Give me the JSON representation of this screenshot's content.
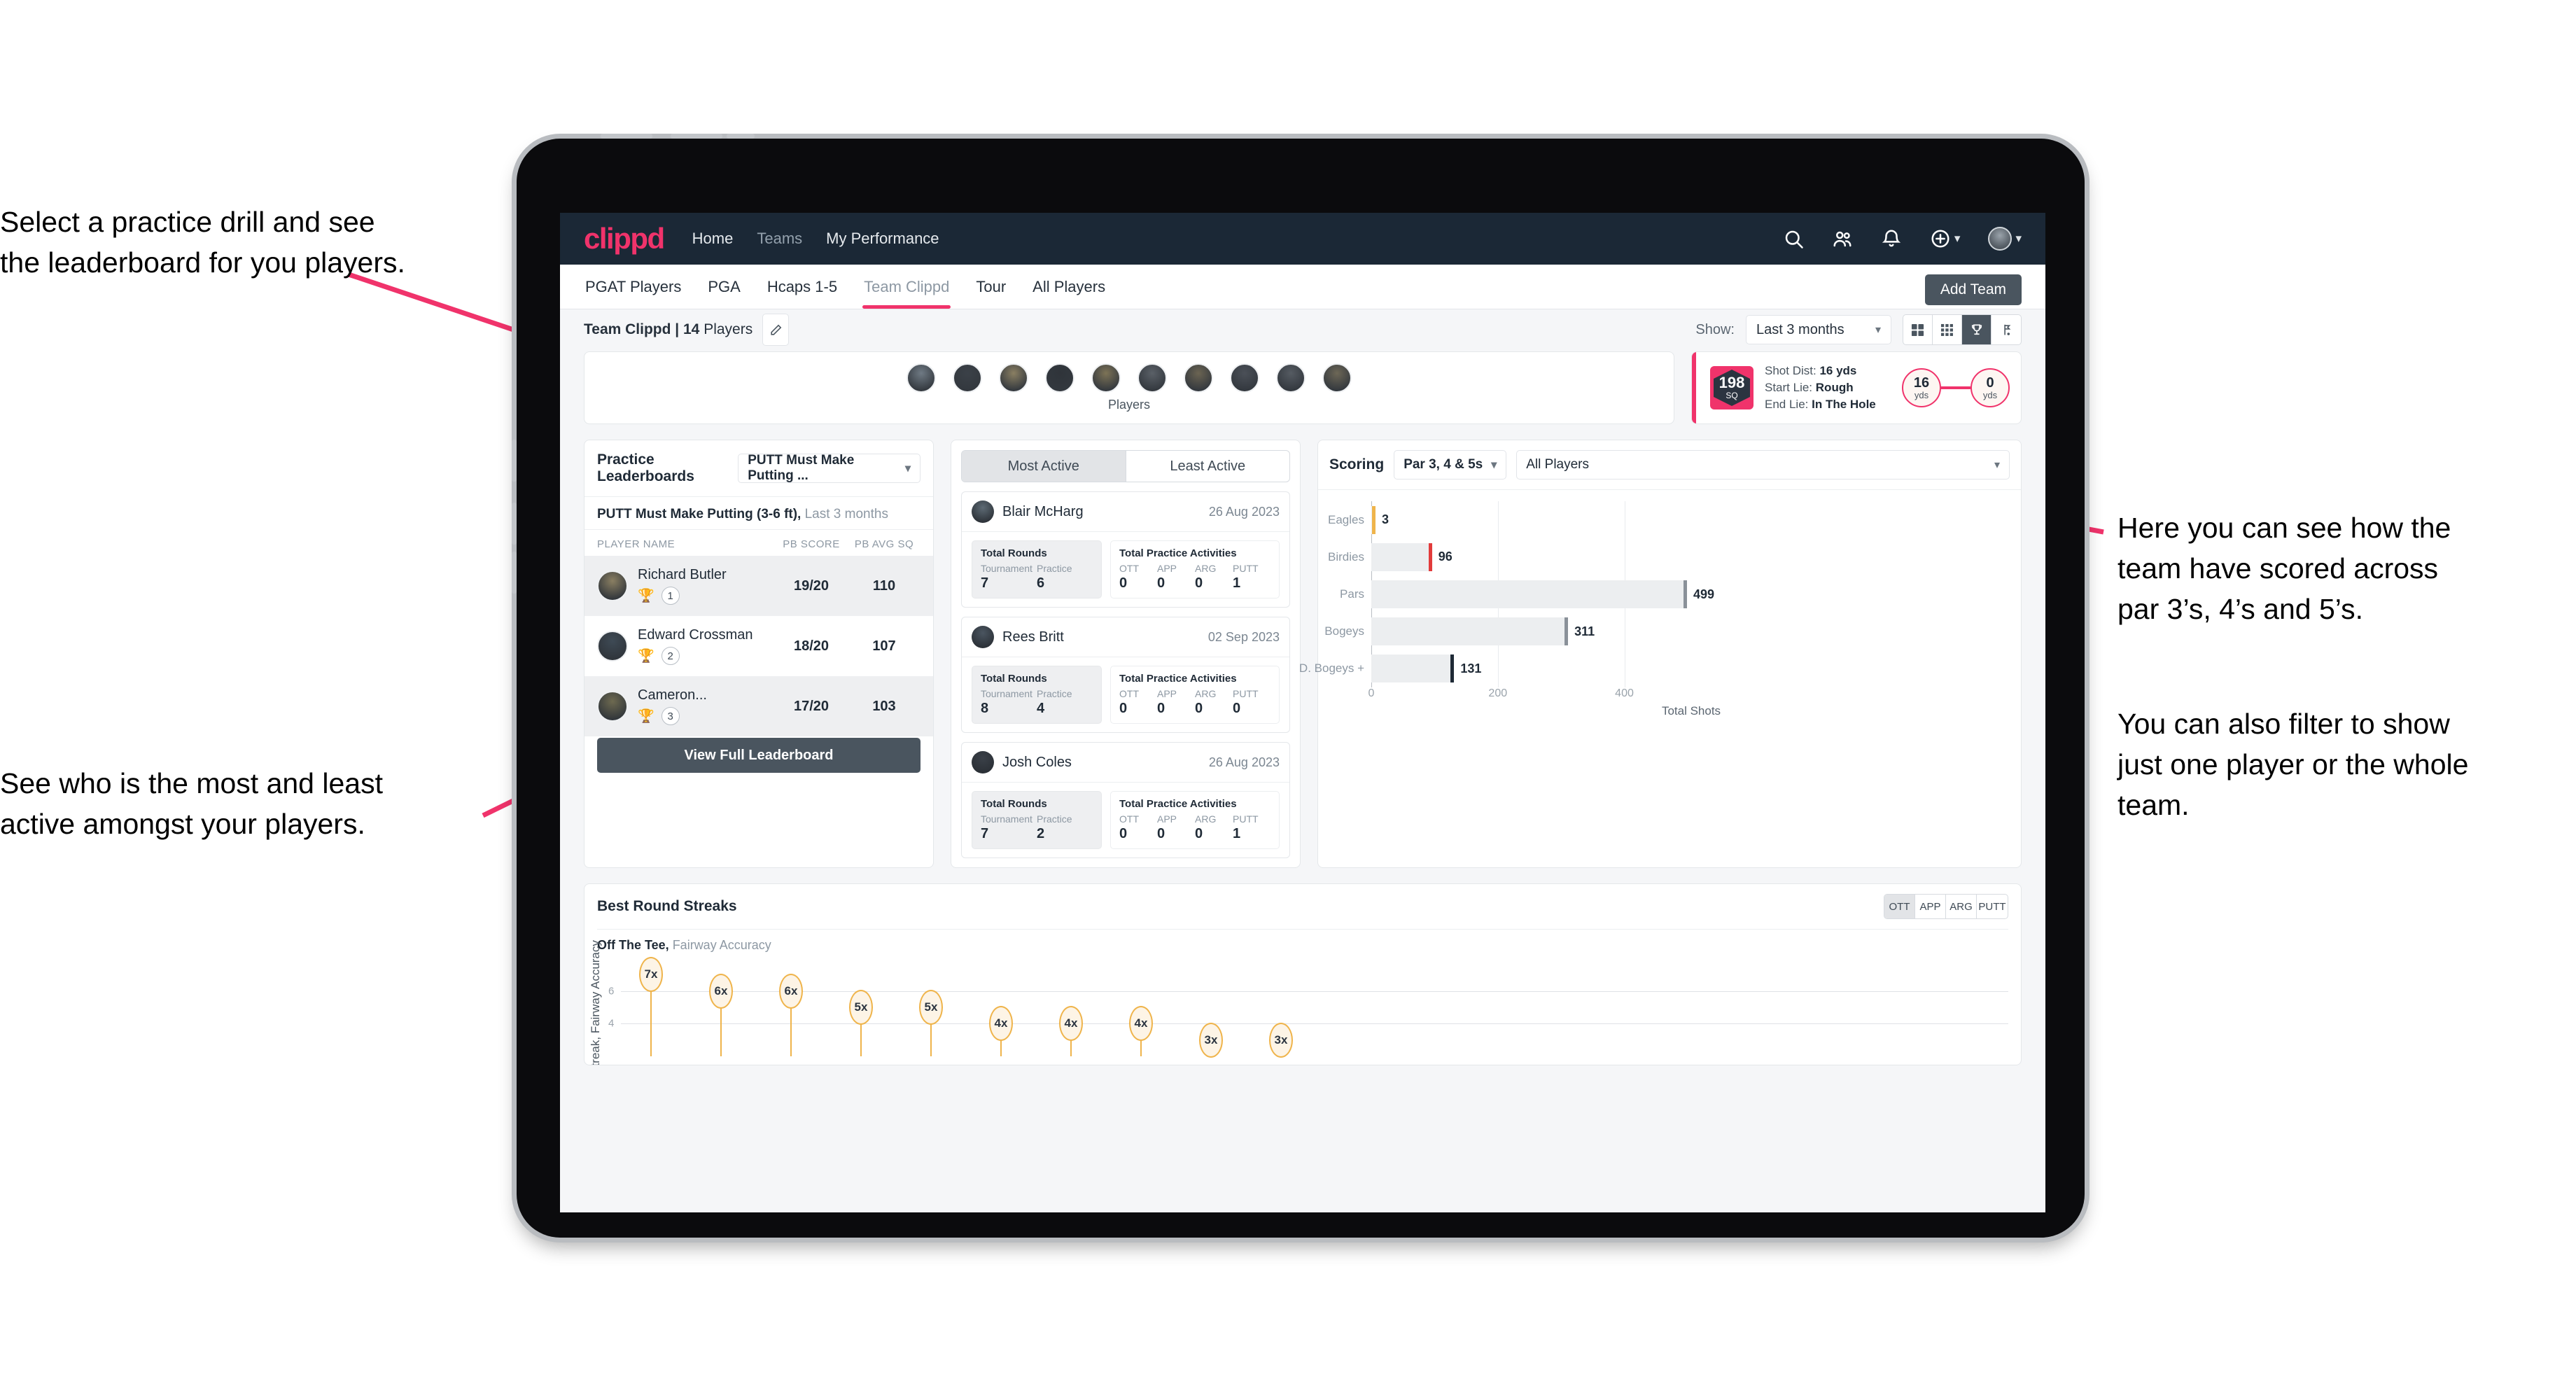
{
  "annotations": {
    "drill": "Select a practice drill and see\nthe leaderboard for you players.",
    "active": "See who is the most and least\nactive amongst your players.",
    "scoring": "Here you can see how the\nteam have scored across\npar 3’s, 4’s and 5’s.",
    "filter": "You can also filter to show\njust one player or the whole\nteam."
  },
  "app": {
    "logo": "clippd",
    "nav": [
      {
        "label": "Home",
        "active": true
      },
      {
        "label": "Teams",
        "active": false
      },
      {
        "label": "My Performance",
        "active": true
      }
    ],
    "icons": [
      "search-icon",
      "people-icon",
      "bell-icon",
      "plus-circle-icon",
      "avatar"
    ]
  },
  "tabs": [
    {
      "label": "PGAT Players",
      "active": false
    },
    {
      "label": "PGA",
      "active": false
    },
    {
      "label": "Hcaps 1-5",
      "active": false
    },
    {
      "label": "Team Clippd",
      "active": true
    },
    {
      "label": "Tour",
      "active": false
    },
    {
      "label": "All Players",
      "active": false
    }
  ],
  "toolbar": {
    "add_team_label": "Add Team",
    "team_label_bold": "Team Clippd | 14",
    "team_label_rest": " Players",
    "edit_icon": "pencil-icon",
    "show_label": "Show:",
    "show_value": "Last 3 months",
    "view_modes": [
      {
        "name": "grid-4-icon",
        "active": false
      },
      {
        "name": "grid-9-icon",
        "active": false
      },
      {
        "name": "trophy-icon",
        "active": true
      },
      {
        "name": "golf-flag-icon",
        "active": false
      }
    ]
  },
  "players_strip": {
    "label": "Players",
    "count": 10
  },
  "shot_card": {
    "sq_value": "198",
    "sq_unit": "SQ",
    "lines": [
      {
        "key": "Shot Dist:",
        "value": "16 yds"
      },
      {
        "key": "Start Lie:",
        "value": "Rough"
      },
      {
        "key": "End Lie:",
        "value": "In The Hole"
      }
    ],
    "start_dist": "16",
    "start_unit": "yds",
    "end_dist": "0",
    "end_unit": "yds"
  },
  "leaderboard": {
    "title": "Practice Leaderboards",
    "drill_select": "PUTT Must Make Putting ...",
    "subtitle_bold": "PUTT Must Make Putting (3-6 ft),",
    "subtitle_rest": " Last 3 months",
    "columns": [
      "PLAYER NAME",
      "PB SCORE",
      "PB AVG SQ"
    ],
    "rows": [
      {
        "name": "Richard Butler",
        "rank": "1",
        "trophy": "gold",
        "pb_score": "19/20",
        "pb_avg_sq": "110"
      },
      {
        "name": "Edward Crossman",
        "rank": "2",
        "trophy": "silver",
        "pb_score": "18/20",
        "pb_avg_sq": "107"
      },
      {
        "name": "Cameron...",
        "rank": "3",
        "trophy": "bronze",
        "pb_score": "17/20",
        "pb_avg_sq": "103"
      }
    ],
    "button": "View Full Leaderboard"
  },
  "activity": {
    "segments": [
      {
        "label": "Most Active",
        "active": true
      },
      {
        "label": "Least Active",
        "active": false
      }
    ],
    "rounds_title": "Total Rounds",
    "rounds_keys": [
      "Tournament",
      "Practice"
    ],
    "practice_title": "Total Practice Activities",
    "practice_keys": [
      "OTT",
      "APP",
      "ARG",
      "PUTT"
    ],
    "cards": [
      {
        "name": "Blair McHarg",
        "date": "26 Aug 2023",
        "rounds": [
          "7",
          "6"
        ],
        "practice": [
          "0",
          "0",
          "0",
          "1"
        ]
      },
      {
        "name": "Rees Britt",
        "date": "02 Sep 2023",
        "rounds": [
          "8",
          "4"
        ],
        "practice": [
          "0",
          "0",
          "0",
          "0"
        ]
      },
      {
        "name": "Josh Coles",
        "date": "26 Aug 2023",
        "rounds": [
          "7",
          "2"
        ],
        "practice": [
          "0",
          "0",
          "0",
          "1"
        ]
      }
    ]
  },
  "scoring": {
    "title": "Scoring",
    "par_select": "Par 3, 4 & 5s",
    "player_select": "All Players"
  },
  "streaks": {
    "title": "Best Round Streaks",
    "segments": [
      {
        "label": "OTT",
        "active": true
      },
      {
        "label": "APP",
        "active": false
      },
      {
        "label": "ARG",
        "active": false
      },
      {
        "label": "PUTT",
        "active": false
      }
    ],
    "subtitle_bold": "Off The Tee,",
    "subtitle_rest": " Fairway Accuracy"
  },
  "colors": {
    "accent_pink": "#f0336b",
    "header_dark": "#1b2836",
    "button_slate": "#4a555f",
    "streak_gold": "#efb44b"
  },
  "chart_data": [
    {
      "type": "bar",
      "orientation": "horizontal",
      "title": "Scoring",
      "categories": [
        "Eagles",
        "Birdies",
        "Pars",
        "Bogeys",
        "D. Bogeys +"
      ],
      "values": [
        3,
        96,
        499,
        311,
        131
      ],
      "cap_colors": [
        "#efb44b",
        "#e23b3b",
        "#8a9199",
        "#8a9199",
        "#1f2a36"
      ],
      "xlabel": "Total Shots",
      "ylabel": "",
      "xlim": [
        0,
        520
      ],
      "xticks": [
        0,
        200,
        400
      ],
      "grid": true,
      "legend": "none"
    },
    {
      "type": "scatter",
      "title": "Best Round Streaks",
      "subtitle": "Off The Tee, Fairway Accuracy",
      "ylabel": "Streak, Fairway Accuracy",
      "xlabel": "",
      "values": [
        7,
        6,
        6,
        5,
        5,
        4,
        4,
        4,
        3,
        3
      ],
      "labels": [
        "7x",
        "6x",
        "6x",
        "5x",
        "5x",
        "4x",
        "4x",
        "4x",
        "3x",
        "3x"
      ],
      "yticks": [
        4,
        6
      ],
      "ylim": [
        2,
        8
      ],
      "grid": true,
      "marker": "oval-gold"
    }
  ]
}
